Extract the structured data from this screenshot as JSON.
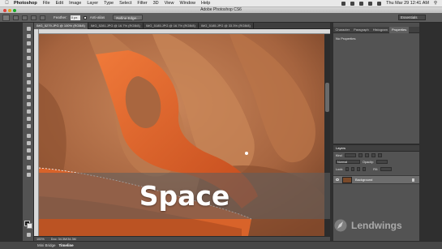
{
  "menubar": {
    "app": "Photoshop",
    "items": [
      "File",
      "Edit",
      "Image",
      "Layer",
      "Type",
      "Select",
      "Filter",
      "3D",
      "View",
      "Window",
      "Help"
    ],
    "clock": "Thu Mar 29  12:41 AM"
  },
  "window": {
    "title": "Adobe Photoshop CS6"
  },
  "options_bar": {
    "feather_label": "Feather:",
    "feather_value": "0 px",
    "antialias_label": "Anti-alias",
    "refine_edge_label": "Refine Edge...",
    "workspace": "Essentials"
  },
  "document_tabs": [
    {
      "label": "IMG_5279.JPG @ 100% (RGB/8)",
      "active": true
    },
    {
      "label": "IMG_5281.JPG @ 16.7% (RGB/8)",
      "active": false
    },
    {
      "label": "IMG_5185.JPG @ 16.7% (RGB/8)",
      "active": false
    },
    {
      "label": "IMG_5185.JPG @ 33.3% (RGB/8)",
      "active": false
    }
  ],
  "status_bar": {
    "zoom": "100%",
    "doc_info": "Doc: 34.3M/34.3M"
  },
  "bottom_bar": {
    "mini_bridge": "Mini Bridge",
    "timeline": "Timeline"
  },
  "panels": {
    "tabs": [
      "Character",
      "Paragraph",
      "Histogram",
      "Properties"
    ],
    "active_tab": "Properties",
    "properties_text": "No Properties",
    "layers_title": "Layers",
    "kind_label": "Kind",
    "blend_mode": "Normal",
    "opacity_label": "Opacity:",
    "lock_label": "Lock:",
    "fill_label": "Fill:",
    "layer_name": "Background"
  },
  "caption": {
    "text": "Space"
  },
  "watermark": {
    "text": "Lendwings"
  },
  "colors": {
    "scissor_orange": "#e0652c",
    "skin": "#b0714b"
  }
}
